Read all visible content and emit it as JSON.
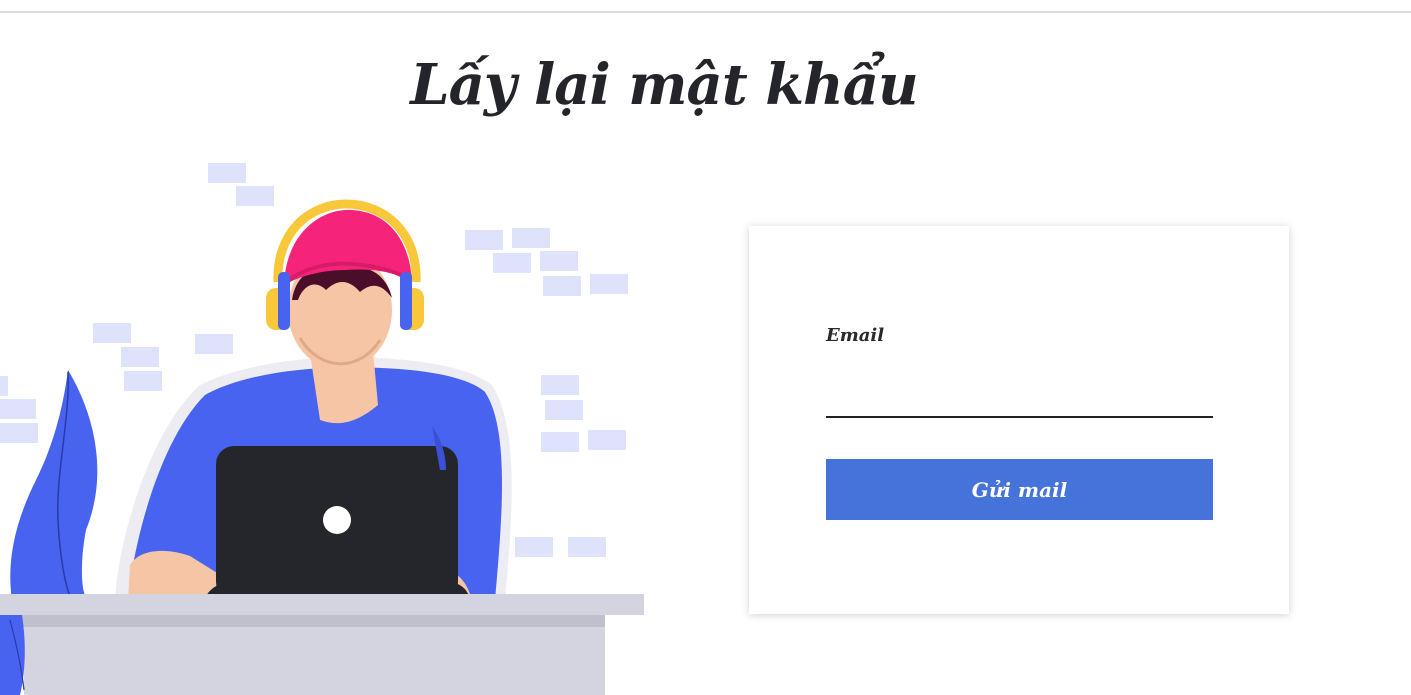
{
  "header": {
    "title": "Lấy lại mật khẩu"
  },
  "illustration": {
    "subject": "person-with-headphones-at-laptop",
    "colors": {
      "shirt": "#4763f0",
      "cap": "#f6237a",
      "headphones": "#f8c83a",
      "laptop": "#24262b",
      "skin": "#f6c5a6",
      "desk": "#d4d4e0",
      "bricks": "#dfe2fb"
    }
  },
  "form": {
    "email_label": "Email",
    "email_value": "",
    "email_placeholder": "",
    "submit_label": "Gửi mail"
  },
  "colors": {
    "accent": "#4573d9",
    "title": "#24252b",
    "background": "#ffffff"
  }
}
